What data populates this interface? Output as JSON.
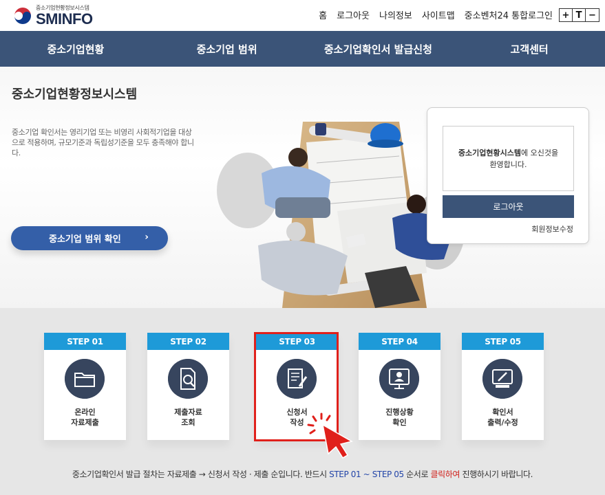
{
  "header": {
    "logo_sub": "중소기업현황정보시스템",
    "logo_main": "SMINFO",
    "links": [
      "홈",
      "로그아웃",
      "나의정보",
      "사이트맵",
      "중소벤처24 통합로그인"
    ],
    "font_controls": [
      "+",
      "T",
      "−"
    ]
  },
  "nav": {
    "items": [
      "중소기업현황",
      "중소기업 범위",
      "중소기업확인서 발급신청",
      "고객센터"
    ]
  },
  "hero": {
    "title": "중소기업현황정보시스템",
    "description": "중소기업 확인서는 영리기업 또는 비영리 사회적기업을 대상으로 적용하며, 규모기준과 독립성기준을 모두 충족해야 합니다.",
    "button_label": "중소기업 범위 확인",
    "button_arrow": "›"
  },
  "login": {
    "welcome_bold": "중소기업현황시스템",
    "welcome_rest": "에 오신것을",
    "welcome_line2": "환영합니다.",
    "logout_label": "로그아웃",
    "edit_label": "회원정보수정"
  },
  "steps": [
    {
      "head": "STEP 01",
      "line1": "온라인",
      "line2": "자료제출",
      "icon": "folder-icon"
    },
    {
      "head": "STEP 02",
      "line1": "제출자료",
      "line2": "조회",
      "icon": "document-search-icon"
    },
    {
      "head": "STEP 03",
      "line1": "신청서",
      "line2": "작성",
      "icon": "document-edit-icon"
    },
    {
      "head": "STEP 04",
      "line1": "진행상황",
      "line2": "확인",
      "icon": "monitor-user-icon"
    },
    {
      "head": "STEP 05",
      "line1": "확인서",
      "line2": "출력/수정",
      "icon": "printer-icon"
    }
  ],
  "notice": {
    "part1": "중소기업확인서 발급 절차는 자료제출 → 신청서 작성 · 제출 순입니다. 반드시 ",
    "blue": "STEP 01 ~ STEP 05",
    "part2": " 순서로 ",
    "red": "클릭하여",
    "part3": " 진행하시기 바랍니다."
  },
  "colors": {
    "nav_bg": "#3b5478",
    "step_head": "#1e9ad8",
    "icon_circle": "#37455e",
    "hero_button": "#345fa8",
    "highlight": "#e0201b"
  }
}
